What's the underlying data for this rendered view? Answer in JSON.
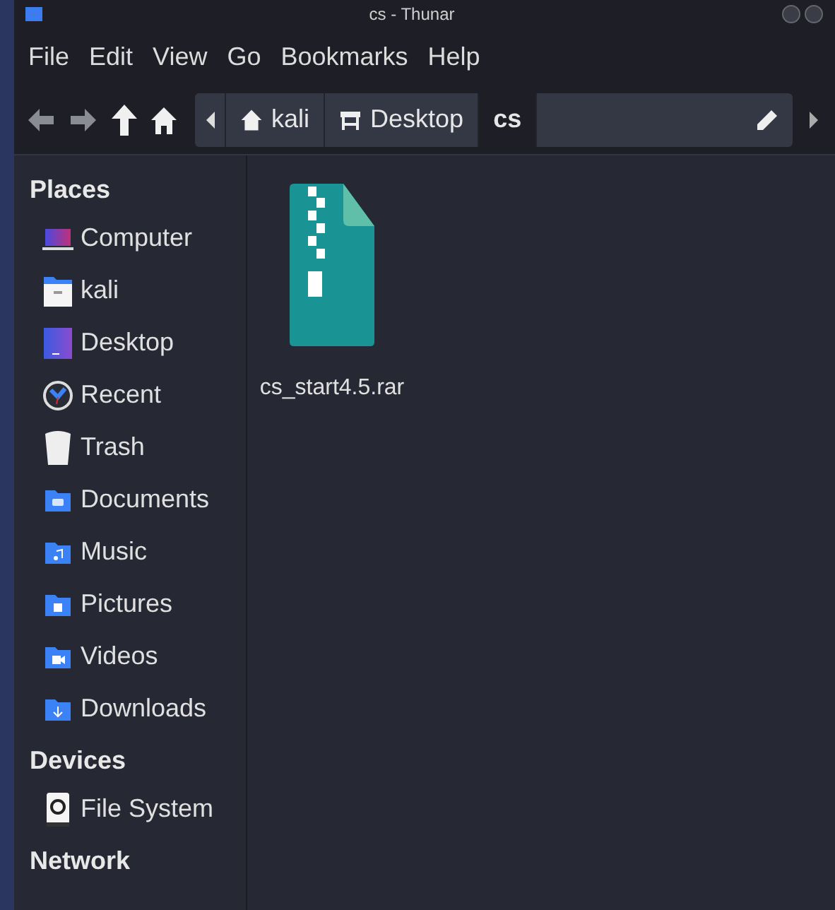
{
  "window": {
    "title": "cs - Thunar"
  },
  "menu": [
    "File",
    "Edit",
    "View",
    "Go",
    "Bookmarks",
    "Help"
  ],
  "path": [
    {
      "label": "kali",
      "kind": "home",
      "selected": false
    },
    {
      "label": "Desktop",
      "kind": "desktop",
      "selected": false
    },
    {
      "label": "cs",
      "kind": "plain",
      "selected": true
    }
  ],
  "sidebar": [
    {
      "heading": "Places",
      "items": [
        {
          "label": "Computer",
          "kind": "computer"
        },
        {
          "label": "kali",
          "kind": "home"
        },
        {
          "label": "Desktop",
          "kind": "desktop"
        },
        {
          "label": "Recent",
          "kind": "recent"
        },
        {
          "label": "Trash",
          "kind": "trash"
        },
        {
          "label": "Documents",
          "kind": "documents"
        },
        {
          "label": "Music",
          "kind": "music"
        },
        {
          "label": "Pictures",
          "kind": "pictures"
        },
        {
          "label": "Videos",
          "kind": "videos"
        },
        {
          "label": "Downloads",
          "kind": "downloads"
        }
      ]
    },
    {
      "heading": "Devices",
      "items": [
        {
          "label": "File System",
          "kind": "drive"
        }
      ]
    },
    {
      "heading": "Network"
    }
  ],
  "files": [
    {
      "name": "cs_start4.5.rar",
      "kind": "archive"
    }
  ]
}
